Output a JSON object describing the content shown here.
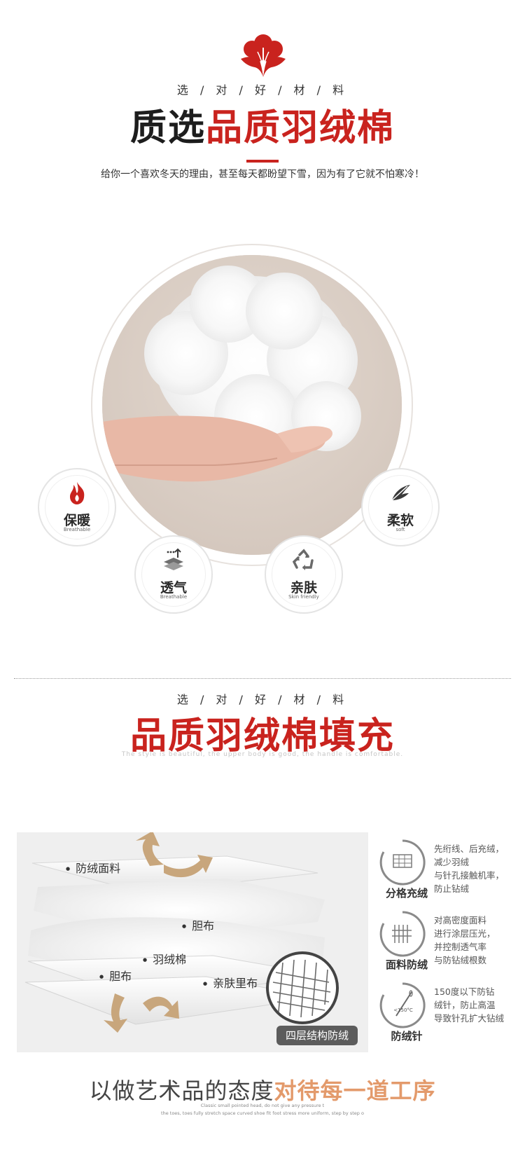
{
  "section1": {
    "kicker": "选 / 对 / 好 / 材 / 料",
    "headline_dark": "质选",
    "headline_red": "品质羽绒棉",
    "tagline": "给你一个喜欢冬天的理由，甚至每天都盼望下雪，因为有了它就不怕寒冷！",
    "features": [
      {
        "cn": "保暖",
        "en": "Breathable",
        "icon": "flame-icon"
      },
      {
        "cn": "柔软",
        "en": "soft",
        "icon": "feather-icon"
      },
      {
        "cn": "透气",
        "en": "Breathable",
        "icon": "layers-arrow-icon"
      },
      {
        "cn": "亲肤",
        "en": "Skin friendly",
        "icon": "recycle-icon"
      }
    ]
  },
  "section2": {
    "kicker": "选 / 对 / 好 / 材 / 料",
    "headline": "品质羽绒棉填充",
    "subline": "The style is beautiful, the upper body is good, the handle is comfortable.",
    "diagram_labels": {
      "outer_fabric": "防绒面料",
      "liner_top": "胆布",
      "wadding": "羽绒棉",
      "liner_bottom": "胆布",
      "lining": "亲肤里布",
      "structure_tag": "四层结构防绒"
    },
    "specs": [
      {
        "title": "分格充绒",
        "lines": [
          "先绗线、后充绒，",
          "减少羽绒",
          "与针孔接触机率，",
          "防止钻绒"
        ],
        "icon": "quilted-grid-icon"
      },
      {
        "title": "面料防绒",
        "lines": [
          "对高密度面料",
          "进行涂层压光，",
          "并控制透气率",
          "与防钻绒根数"
        ],
        "icon": "fabric-coating-icon"
      },
      {
        "title": "防绒针",
        "lines": [
          "150度以下防钻",
          "绒针，防止高温",
          "导致针孔扩大钻绒"
        ],
        "icon": "needle-icon",
        "dial_text": "<150°C"
      }
    ]
  },
  "section3": {
    "lead_grey": "以做艺术品的态度",
    "lead_orange": "对待每一道工序",
    "fine1": "Classic small pointed head, do  not give any pressure t",
    "fine2": "the toes, toes fully stretch space curved shoe fit foot stress more uniform, step by step o"
  },
  "colors": {
    "brand_red": "#c9231e",
    "accent_orange": "#e39a6b",
    "photo_bg": "#d9cdc4"
  }
}
